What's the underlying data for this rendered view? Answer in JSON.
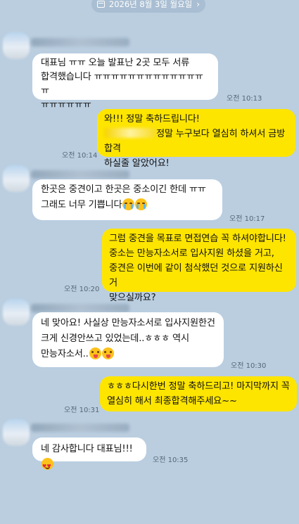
{
  "date_header": {
    "label": "2026년 8월 3일 월요일"
  },
  "messages": [
    {
      "side": "in",
      "lines": [
        "대표님 ㅠㅠ 오늘 발표난 2곳 모두 서류",
        "합격했습니다 ㅠㅠㅠㅠㅠㅠㅠㅠㅠㅠㅠㅠㅠㅠ",
        "ㅠㅠㅠㅠㅠㅠ"
      ],
      "time": "오전 10:13"
    },
    {
      "side": "out",
      "lines": [
        "와!!! 정말 축하드립니다!",
        "정말 누구보다 열심히 하셔서 금방 합격",
        "하실줄 알았어요!"
      ],
      "time": "오전 10:14"
    },
    {
      "side": "in",
      "lines": [
        "한곳은 중견이고 한곳은 중소이긴 한데 ㅠㅠ",
        "그래도 너무 기쁩니다"
      ],
      "time": "오전 10:17"
    },
    {
      "side": "out",
      "lines": [
        "그럼 중견을 목표로 면접연습 꼭 하셔야합니다!",
        "중소는 만능자소서로 입사지원 하셨을 거고,",
        "중견은 이번에 같이 첨삭했던 것으로 지원하신거",
        "맞으실까요?"
      ],
      "time": "오전 10:20"
    },
    {
      "side": "in",
      "lines": [
        "네 맞아요! 사실상 만능자소서로 입사지원한건",
        "크게 신경안쓰고 있었는데..ㅎㅎㅎ 역시",
        "만능자소서.."
      ],
      "time": "오전 10:30"
    },
    {
      "side": "out",
      "lines": [
        "ㅎㅎㅎ다시한번 정말 축하드리고! 마지막까지 꼭",
        "열심히 해서 최종합격해주세요~~"
      ],
      "time": "오전 10:31"
    },
    {
      "side": "in",
      "lines": [
        "네 감사합니다 대표님!!!"
      ],
      "time": "오전 10:35"
    }
  ],
  "emoji_names": [
    "crying-face-icon",
    "winking-tongue-face-icon",
    "heart-eyes-face-icon"
  ]
}
